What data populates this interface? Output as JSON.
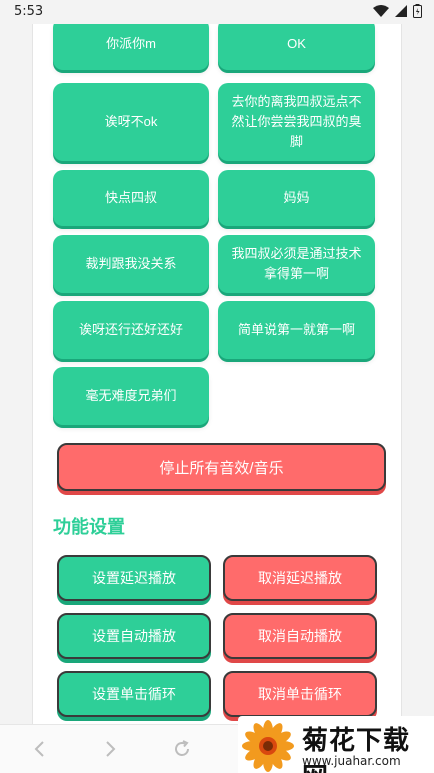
{
  "status": {
    "time": "5:53"
  },
  "sounds": [
    {
      "label": "你派你m"
    },
    {
      "label": "OK"
    },
    {
      "label": "诶呀不ok"
    },
    {
      "label": "去你的离我四叔远点不然让你尝尝我四叔的臭脚"
    },
    {
      "label": "快点四叔"
    },
    {
      "label": "妈妈"
    },
    {
      "label": "裁判跟我没关系"
    },
    {
      "label": "我四叔必须是通过技术拿得第一啊"
    },
    {
      "label": "诶呀还行还好还好"
    },
    {
      "label": "简单说第一就第一啊"
    },
    {
      "label": "毫无难度兄弟们"
    }
  ],
  "stop_all": {
    "label": "停止所有音效/音乐"
  },
  "settings": {
    "title": "功能设置",
    "buttons": [
      {
        "label": "设置延迟播放"
      },
      {
        "label": "取消延迟播放"
      },
      {
        "label": "设置自动播放"
      },
      {
        "label": "取消自动播放"
      },
      {
        "label": "设置单击循环"
      },
      {
        "label": "取消单击循环"
      }
    ]
  },
  "watermark": {
    "title": "菊花下载网",
    "url": "www.juahar.com"
  },
  "colors": {
    "green": "#2ecf98",
    "red": "#ff6b6b"
  }
}
